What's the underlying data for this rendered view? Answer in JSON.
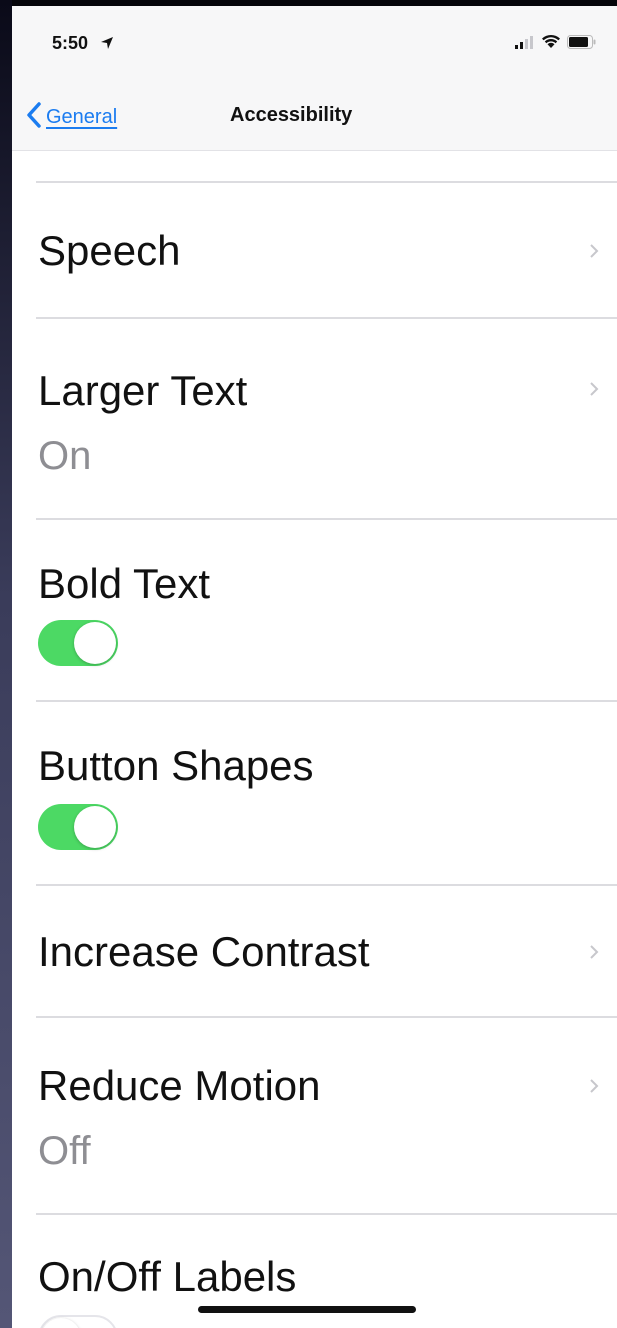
{
  "status_bar": {
    "time": "5:50",
    "location_icon": "location-arrow-icon",
    "signal_icon": "cellular-signal-icon",
    "wifi_icon": "wifi-icon",
    "battery_icon": "battery-icon"
  },
  "nav": {
    "back_label": "General",
    "back_icon": "chevron-left-icon",
    "title": "Accessibility"
  },
  "rows": [
    {
      "label": "Speech",
      "type": "link"
    },
    {
      "label": "Larger Text",
      "value": "On",
      "type": "link"
    },
    {
      "label": "Bold Text",
      "type": "toggle",
      "toggle_on": true
    },
    {
      "label": "Button Shapes",
      "type": "toggle",
      "toggle_on": true
    },
    {
      "label": "Increase Contrast",
      "type": "link"
    },
    {
      "label": "Reduce Motion",
      "value": "Off",
      "type": "link"
    },
    {
      "label": "On/Off Labels",
      "type": "toggle",
      "toggle_on": false
    }
  ],
  "colors": {
    "accent_blue": "#1b7cf0",
    "toggle_green": "#4cd964",
    "secondary_text": "#8e8e93"
  }
}
